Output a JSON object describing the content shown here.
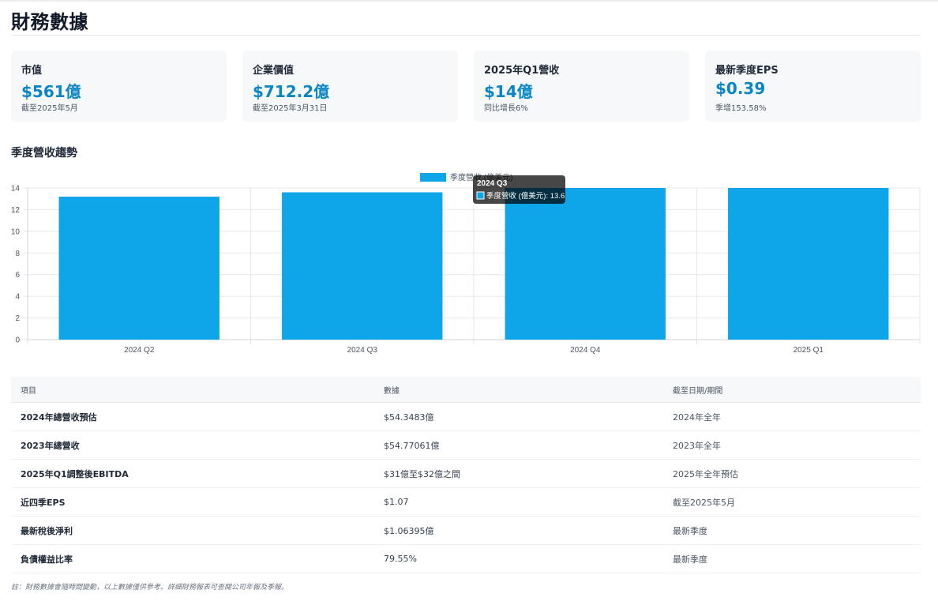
{
  "page": {
    "title": "財務數據"
  },
  "cards": [
    {
      "label": "市值",
      "value": "$561億",
      "note": "截至2025年5月"
    },
    {
      "label": "企業價值",
      "value": "$712.2億",
      "note": "截至2025年3月31日"
    },
    {
      "label": "2025年Q1營收",
      "value": "$14億",
      "note": "同比增長6%"
    },
    {
      "label": "最新季度EPS",
      "value": "$0.39",
      "note": "季增153.58%"
    }
  ],
  "section": {
    "title": "季度營收趨勢"
  },
  "chart_data": {
    "type": "bar",
    "categories": [
      "2024 Q2",
      "2024 Q3",
      "2024 Q4",
      "2025 Q1"
    ],
    "series": [
      {
        "name": "季度營收 (億美元)",
        "values": [
          13.2,
          13.6,
          14.0,
          14.0
        ]
      }
    ],
    "ylim": [
      0,
      14
    ],
    "yticks": [
      0,
      2,
      4,
      6,
      8,
      10,
      12,
      14
    ],
    "grid": true,
    "legend": "top-center",
    "bar_color": "#0ea5e9",
    "tooltip": {
      "title": "2024 Q3",
      "text": "季度營收 (億美元): 13.6"
    }
  },
  "table": {
    "headers": [
      "項目",
      "數據",
      "截至日期/期間"
    ],
    "rows": [
      [
        "2024年總營收預估",
        "$54.3483億",
        "2024年全年"
      ],
      [
        "2023年總營收",
        "$54.77061億",
        "2023年全年"
      ],
      [
        "2025年Q1調整後EBITDA",
        "$31億至$32億之間",
        "2025年全年預估"
      ],
      [
        "近四季EPS",
        "$1.07",
        "截至2025年5月"
      ],
      [
        "最新稅後淨利",
        "$1.06395億",
        "最新季度"
      ],
      [
        "負債權益比率",
        "79.55%",
        "最新季度"
      ]
    ]
  },
  "footnote": "註：財務數據會隨時間變動，以上數據僅供參考。詳細財務報表可查閱公司年報及季報。"
}
